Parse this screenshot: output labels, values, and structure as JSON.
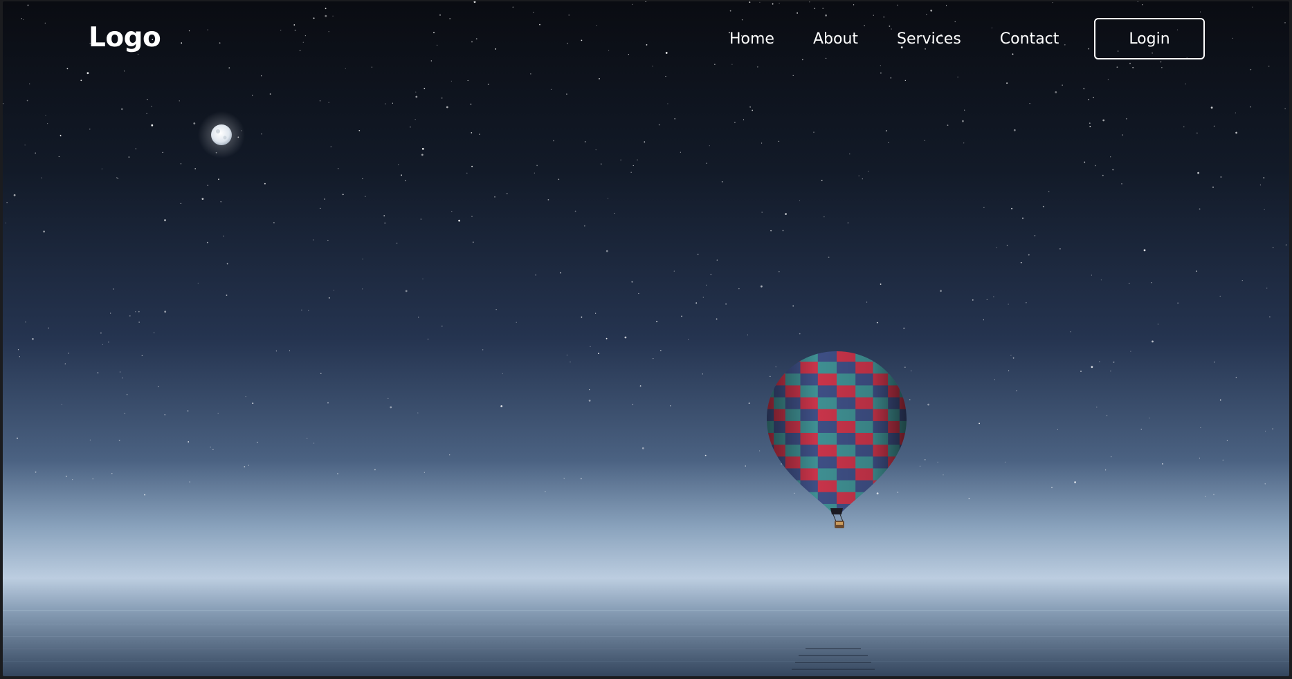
{
  "nav": {
    "logo": "Logo",
    "links": [
      "Home",
      "About",
      "Services",
      "Contact"
    ],
    "login_label": "Login"
  },
  "hero": {
    "sky_top": "#0b0e15",
    "sky_mid": "#2a3a55",
    "horizon_glow": "#b8cadc",
    "water": "#4a5f7a",
    "moon": "#dfe6ee",
    "balloon_red": "#c8344a",
    "balloon_teal": "#3f8f92",
    "balloon_blue": "#3e4f85",
    "icons": [
      "moon-icon",
      "hot-air-balloon-icon"
    ]
  }
}
